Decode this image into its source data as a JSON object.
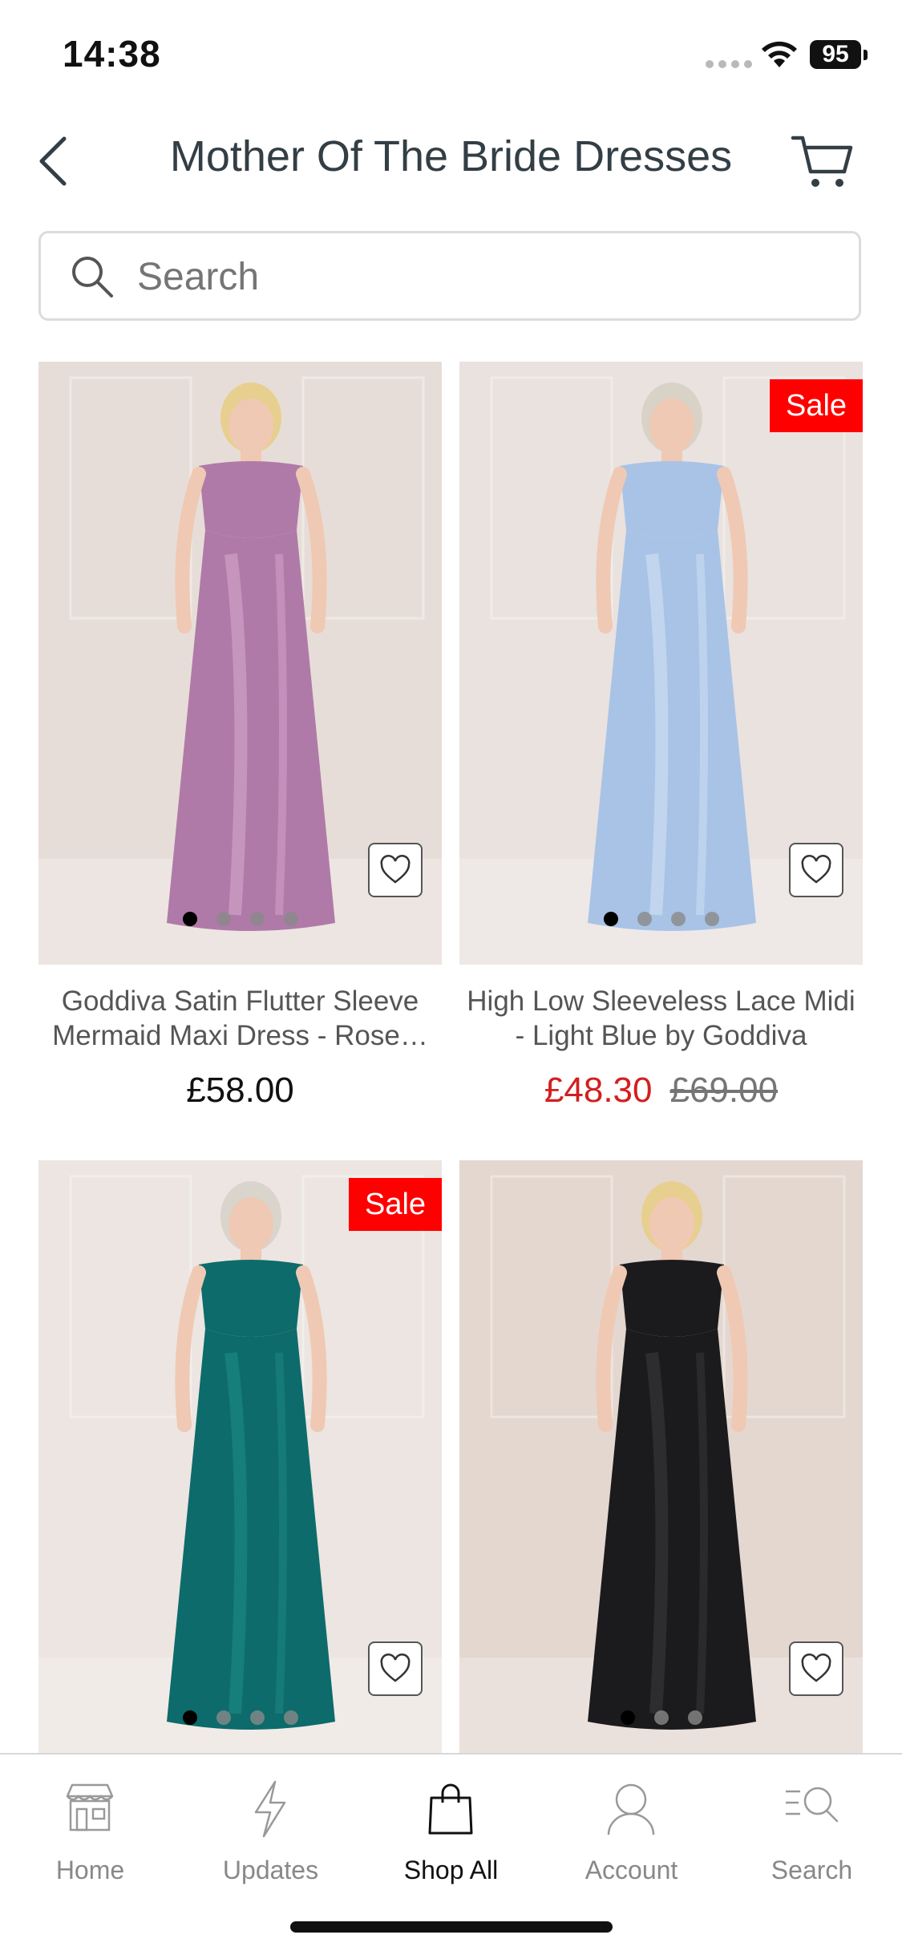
{
  "status_bar": {
    "time": "14:38",
    "battery": "95"
  },
  "header": {
    "title": "Mother Of The Bride Dresses"
  },
  "search": {
    "placeholder": "Search"
  },
  "products": [
    {
      "name": "Goddiva Satin Flutter Sleeve Mermaid Maxi Dress - Rose…",
      "price": "£58.00",
      "sale": false,
      "image_dots": 4,
      "colors": {
        "bg": "#e7ddd8",
        "dress": "#b07aa8",
        "dress_light": "#d4a6cc",
        "skin": "#efc9b4",
        "hair": "#e7cf8f"
      }
    },
    {
      "name": "High Low Sleeveless Lace Midi - Light Blue by Goddiva",
      "sale_badge": "Sale",
      "sale_price": "£48.30",
      "original_price": "£69.00",
      "sale": true,
      "image_dots": 4,
      "colors": {
        "bg": "#e9e2df",
        "dress": "#a9c3e6",
        "dress_light": "#d2e1f4",
        "skin": "#efc9b4",
        "hair": "#d9d2c6"
      }
    },
    {
      "sale_badge": "Sale",
      "sale": true,
      "image_dots": 4,
      "colors": {
        "bg": "#ece5e1",
        "dress": "#0d6b6b",
        "dress_light": "#1d8a85",
        "skin": "#efc9b4",
        "hair": "#d9d4cc"
      }
    },
    {
      "sale": false,
      "image_dots": 3,
      "colors": {
        "bg": "#e4d7d0",
        "dress": "#1b1b1d",
        "dress_light": "#3a3a3d",
        "skin": "#efc9b4",
        "hair": "#e7cf8f"
      }
    }
  ],
  "bottom_nav": {
    "items": [
      {
        "label": "Home",
        "icon": "store-icon"
      },
      {
        "label": "Updates",
        "icon": "lightning-icon"
      },
      {
        "label": "Shop All",
        "icon": "shopping-bag-icon",
        "active": true
      },
      {
        "label": "Account",
        "icon": "user-icon"
      },
      {
        "label": "Search",
        "icon": "search-list-icon"
      }
    ]
  },
  "theme": {
    "sale_red": "#ff0000",
    "sale_price_red": "#d21f1f",
    "text_dark": "#333e45"
  }
}
